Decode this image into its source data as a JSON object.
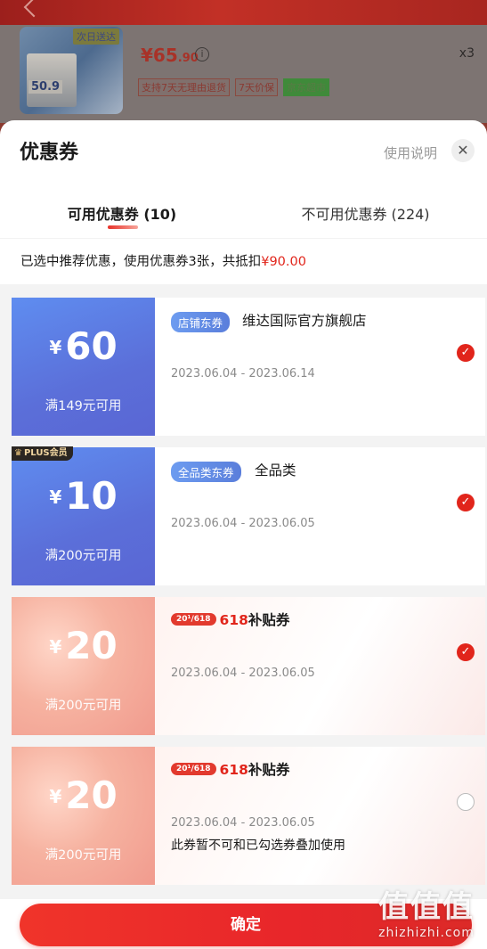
{
  "product": {
    "thumb_tag": "次日送达",
    "thumb_number": "50.9",
    "price_int": "¥65",
    "price_dec": ".90",
    "info_icon": "i",
    "tags": [
      "支持7天无理由退货",
      "7天价保",
      "京东超市"
    ],
    "quantity": "x3"
  },
  "sheet": {
    "title": "优惠券",
    "usage_link": "使用说明",
    "close_icon": "✕"
  },
  "tabs": {
    "available": "可用优惠券 (10)",
    "unavailable": "不可用优惠券 (224)"
  },
  "summary": {
    "text": "已选中推荐优惠，使用优惠券3张，共抵扣",
    "amount": "¥90.00"
  },
  "coupons": [
    {
      "currency": "¥",
      "amount": "60",
      "condition": "满149元可用",
      "badge": "店铺东券",
      "name": "维达国际官方旗舰店",
      "date": "2023.06.04 - 2023.06.14",
      "selected": true
    },
    {
      "plus_tag": "PLUS会员",
      "currency": "¥",
      "amount": "10",
      "condition": "满200元可用",
      "badge": "全品类东券",
      "name": "全品类",
      "date": "2023.06.04 - 2023.06.05",
      "selected": true
    },
    {
      "currency": "¥",
      "amount": "20",
      "condition": "满200元可用",
      "pill": "20¹/618",
      "title_red": "618",
      "title_rest": "补贴券",
      "date": "2023.06.04 - 2023.06.05",
      "selected": true
    },
    {
      "currency": "¥",
      "amount": "20",
      "condition": "满200元可用",
      "pill": "20¹/618",
      "title_red": "618",
      "title_rest": "补贴券",
      "date": "2023.06.04 - 2023.06.05",
      "note": "此券暂不可和已勾选券叠加使用",
      "selected": false
    }
  ],
  "check_icon": "✓",
  "footer": {
    "confirm": "确定"
  },
  "watermark": {
    "logo": "值值值",
    "url": "zhizhizhi.com"
  },
  "colors": {
    "accent": "#e1251b",
    "blue_coupon": "#5b6fd9",
    "pink_coupon": "#f19b8e"
  }
}
